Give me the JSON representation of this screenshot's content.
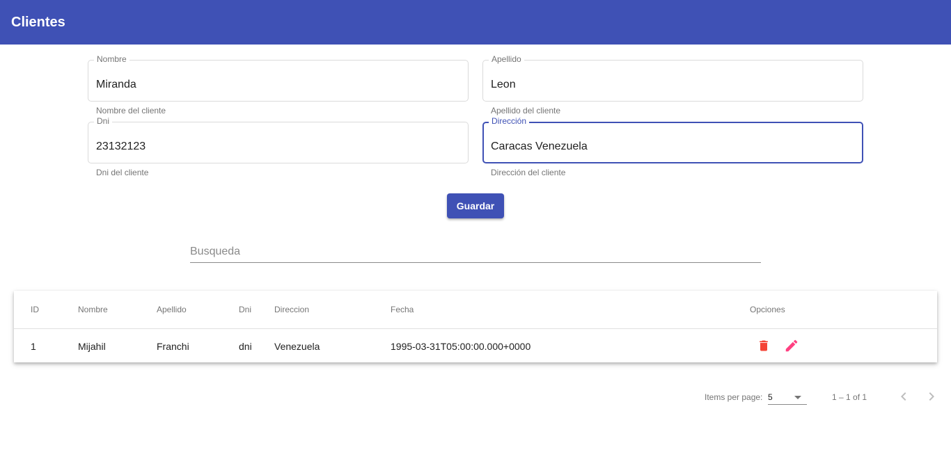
{
  "header": {
    "title": "Clientes"
  },
  "form": {
    "nombre": {
      "label": "Nombre",
      "value": "Miranda",
      "hint": "Nombre del cliente"
    },
    "apellido": {
      "label": "Apellido",
      "value": "Leon",
      "hint": "Apellido del cliente"
    },
    "dni": {
      "label": "Dni",
      "value": "23132123",
      "hint": "Dni del cliente"
    },
    "direccion": {
      "label": "Dirección",
      "value": "Caracas Venezuela",
      "hint": "Dirección del cliente"
    },
    "save_label": "Guardar"
  },
  "search": {
    "placeholder": "Busqueda"
  },
  "table": {
    "columns": [
      "ID",
      "Nombre",
      "Apellido",
      "Dni",
      "Direccion",
      "Fecha",
      "Opciones"
    ],
    "rows": [
      {
        "id": "1",
        "nombre": "Mijahil",
        "apellido": "Franchi",
        "dni": "dni",
        "direccion": "Venezuela",
        "fecha": "1995-03-31T05:00:00.000+0000",
        "actions": [
          "delete-icon",
          "edit-icon"
        ]
      }
    ]
  },
  "paginator": {
    "items_per_page_label": "Items per page:",
    "page_size": "5",
    "range_label": "1 – 1 of 1"
  },
  "colors": {
    "primary": "#3f51b5",
    "delete": "#f44336",
    "edit": "#ff4081"
  }
}
